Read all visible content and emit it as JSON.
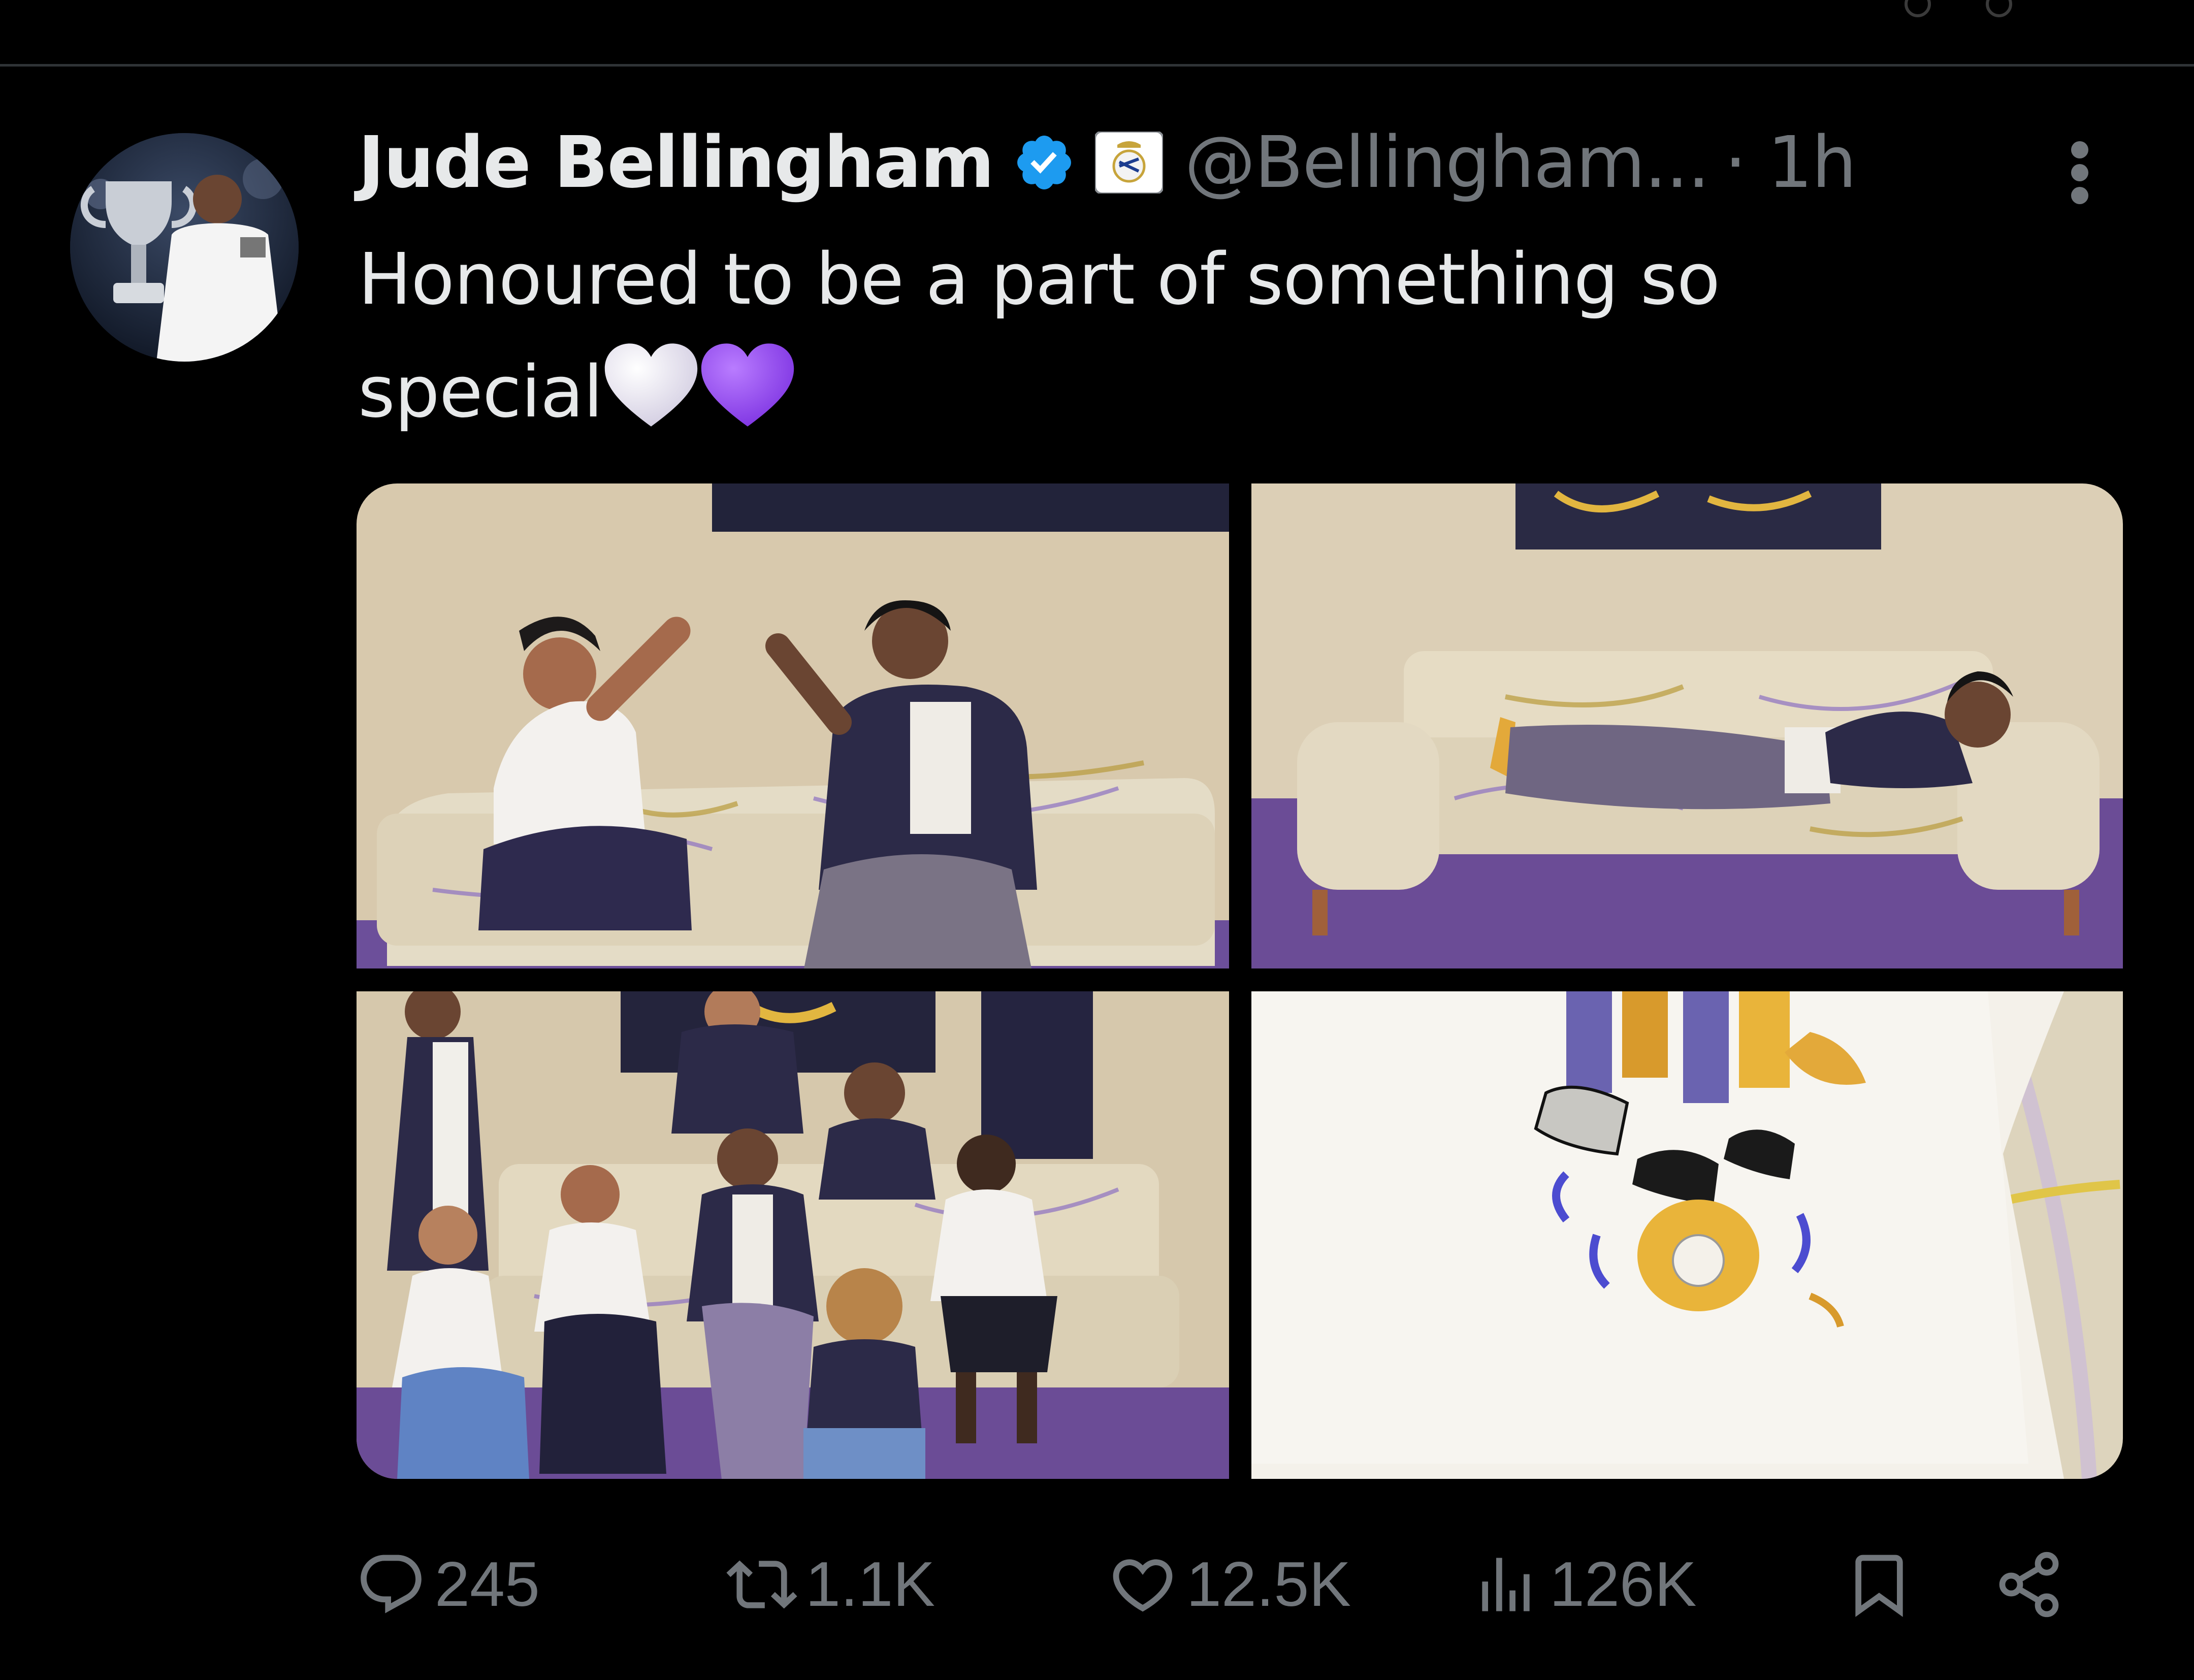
{
  "tweet": {
    "author": {
      "display_name": "Jude Bellingham",
      "handle": "@Bellingham...",
      "time": "· 1h",
      "verified": true,
      "affiliation": "real-madrid-badge"
    },
    "text_line1": "Honoured to be a part of something so",
    "text_line2": "special",
    "emojis": [
      "white-heart",
      "purple-heart"
    ],
    "media": [
      {
        "label": "photo-high-five-on-sofa"
      },
      {
        "label": "photo-lying-on-sofa"
      },
      {
        "label": "photo-group-on-sofa"
      },
      {
        "label": "photo-tshirt-closeup"
      }
    ]
  },
  "actions": {
    "reply_count": "245",
    "retweet_count": "1.1K",
    "like_count": "12.5K",
    "view_count": "126K"
  },
  "colors": {
    "background": "#000000",
    "text_primary": "#e7e9ea",
    "text_secondary": "#71767b",
    "verified_blue": "#1d9bf0",
    "divider": "#2f3336"
  }
}
